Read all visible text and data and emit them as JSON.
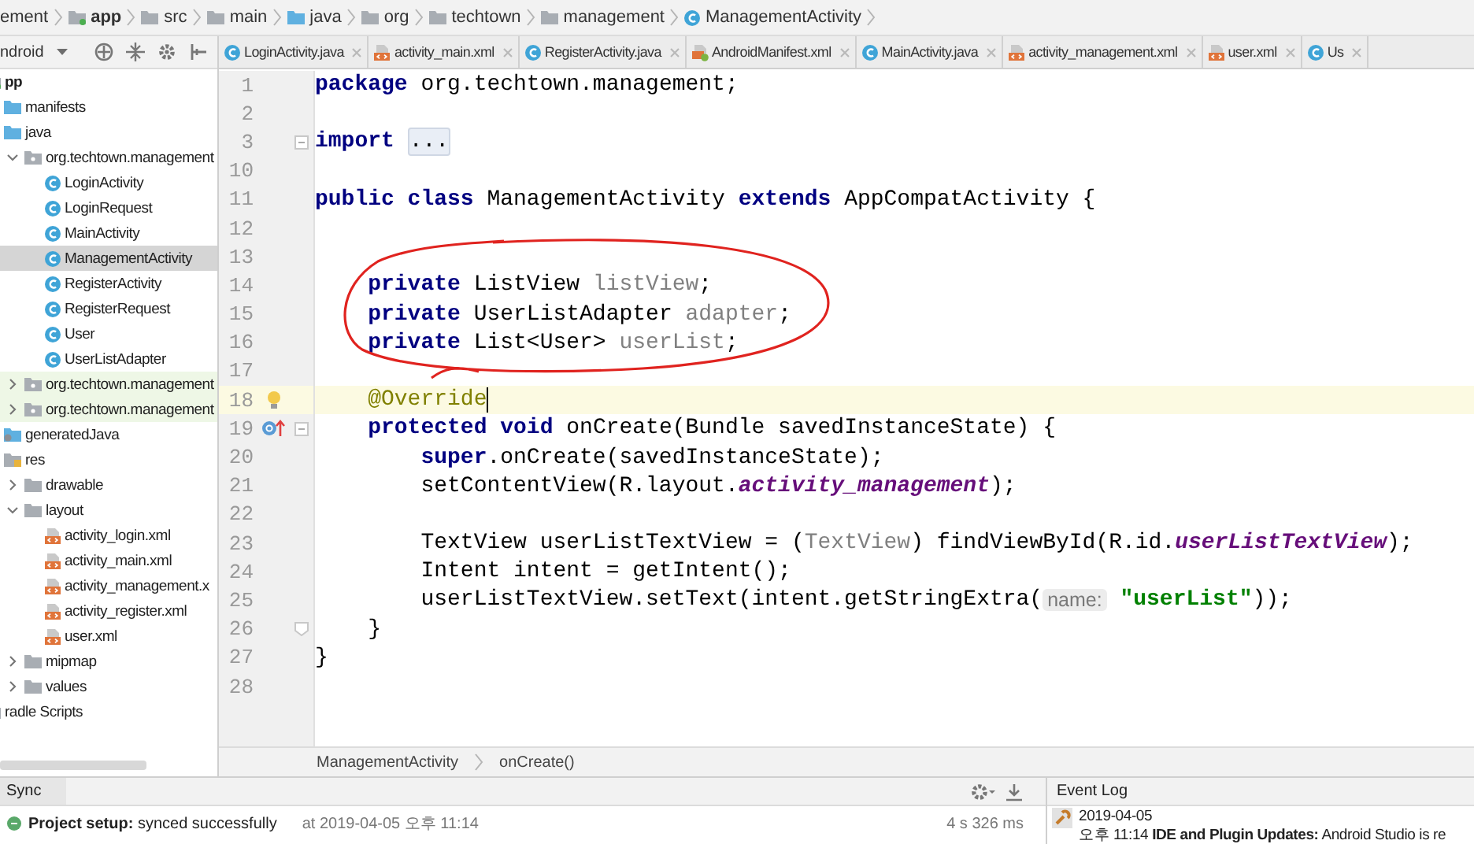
{
  "breadcrumb": [
    {
      "label": "ement",
      "kind": "plain"
    },
    {
      "label": "app",
      "kind": "module"
    },
    {
      "label": "src",
      "kind": "folder"
    },
    {
      "label": "main",
      "kind": "folder"
    },
    {
      "label": "java",
      "kind": "source-folder"
    },
    {
      "label": "org",
      "kind": "folder"
    },
    {
      "label": "techtown",
      "kind": "folder"
    },
    {
      "label": "management",
      "kind": "folder"
    },
    {
      "label": "ManagementActivity",
      "kind": "class"
    }
  ],
  "project_panel": {
    "view_selector": "ndroid",
    "tree": [
      {
        "label": "pp",
        "kind": "module",
        "children": [
          {
            "label": "manifests",
            "kind": "source-folder"
          },
          {
            "label": "java",
            "kind": "source-folder",
            "children": [
              {
                "label": "org.techtown.management",
                "kind": "package",
                "expanded": true,
                "children": [
                  {
                    "label": "LoginActivity",
                    "kind": "class",
                    "selected": false
                  },
                  {
                    "label": "LoginRequest",
                    "kind": "class",
                    "selected": false
                  },
                  {
                    "label": "MainActivity",
                    "kind": "class",
                    "selected": false
                  },
                  {
                    "label": "ManagementActivity",
                    "kind": "class",
                    "selected": true
                  },
                  {
                    "label": "RegisterActivity",
                    "kind": "class",
                    "selected": false
                  },
                  {
                    "label": "RegisterRequest",
                    "kind": "class",
                    "selected": false
                  },
                  {
                    "label": "User",
                    "kind": "class",
                    "selected": false
                  },
                  {
                    "label": "UserListAdapter",
                    "kind": "class",
                    "selected": false
                  }
                ]
              },
              {
                "label": "org.techtown.management",
                "kind": "test-package",
                "expanded": false
              },
              {
                "label": "org.techtown.management",
                "kind": "test-package",
                "expanded": false
              }
            ]
          },
          {
            "label": "generatedJava",
            "kind": "generated"
          },
          {
            "label": "res",
            "kind": "res",
            "children": [
              {
                "label": "drawable",
                "kind": "folder",
                "expanded": false
              },
              {
                "label": "layout",
                "kind": "folder",
                "expanded": true,
                "children": [
                  {
                    "label": "activity_login.xml",
                    "kind": "xml",
                    "selected": false
                  },
                  {
                    "label": "activity_main.xml",
                    "kind": "xml",
                    "selected": false
                  },
                  {
                    "label": "activity_management.x",
                    "kind": "xml",
                    "selected": false
                  },
                  {
                    "label": "activity_register.xml",
                    "kind": "xml",
                    "selected": false
                  },
                  {
                    "label": "user.xml",
                    "kind": "xml",
                    "selected": false
                  }
                ]
              },
              {
                "label": "mipmap",
                "kind": "folder",
                "expanded": false
              },
              {
                "label": "values",
                "kind": "folder",
                "expanded": false
              }
            ]
          }
        ]
      },
      {
        "label": "radle Scripts",
        "kind": "gradle"
      }
    ]
  },
  "tabs": [
    {
      "label": "LoginActivity.java",
      "kind": "class",
      "selected": false
    },
    {
      "label": "activity_main.xml",
      "kind": "xml",
      "selected": false
    },
    {
      "label": "RegisterActivity.java",
      "kind": "class",
      "selected": false
    },
    {
      "label": "AndroidManifest.xml",
      "kind": "manifest",
      "selected": false
    },
    {
      "label": "MainActivity.java",
      "kind": "class",
      "selected": false
    },
    {
      "label": "activity_management.xml",
      "kind": "xml",
      "selected": false
    },
    {
      "label": "user.xml",
      "kind": "xml",
      "selected": false
    },
    {
      "label": "Us",
      "kind": "class",
      "selected": false
    }
  ],
  "editor": {
    "lines": [
      {
        "number": "1",
        "tokens": [
          {
            "t": "package",
            "kind": "keyword"
          },
          {
            "t": " org.techtown.management;",
            "kind": "plain"
          }
        ]
      },
      {
        "number": "2"
      },
      {
        "number": "3",
        "foldable": true,
        "tokens": [
          {
            "t": "import ",
            "kind": "keyword"
          },
          {
            "t": "...",
            "kind": "folded"
          }
        ]
      },
      {
        "number": "10"
      },
      {
        "number": "11",
        "tokens": [
          {
            "t": "public class",
            "kind": "keyword"
          },
          {
            "t": " ManagementActivity ",
            "kind": "plain"
          },
          {
            "t": "extends",
            "kind": "keyword"
          },
          {
            "t": " AppCompatActivity {",
            "kind": "plain"
          }
        ]
      },
      {
        "number": "12"
      },
      {
        "number": "13"
      },
      {
        "number": "14",
        "tokens": [
          {
            "t": "    private",
            "kind": "keyword"
          },
          {
            "t": " ListView ",
            "kind": "plain"
          },
          {
            "t": "listView",
            "kind": "unused"
          },
          {
            "t": ";",
            "kind": "plain"
          }
        ]
      },
      {
        "number": "15",
        "tokens": [
          {
            "t": "    private",
            "kind": "keyword"
          },
          {
            "t": " UserListAdapter ",
            "kind": "plain"
          },
          {
            "t": "adapter",
            "kind": "unused"
          },
          {
            "t": ";",
            "kind": "plain"
          }
        ]
      },
      {
        "number": "16",
        "tokens": [
          {
            "t": "    private",
            "kind": "keyword"
          },
          {
            "t": " List<User> ",
            "kind": "plain"
          },
          {
            "t": "userList",
            "kind": "unused"
          },
          {
            "t": ";",
            "kind": "plain"
          }
        ]
      },
      {
        "number": "17"
      },
      {
        "number": "18",
        "current": true,
        "intention_bulb": true,
        "tokens": [
          {
            "t": "    @Override",
            "kind": "annotation"
          }
        ]
      },
      {
        "number": "19",
        "overrides": true,
        "foldable": true,
        "tokens": [
          {
            "t": "    protected void",
            "kind": "keyword"
          },
          {
            "t": " onCreate(Bundle savedInstanceState) {",
            "kind": "plain"
          }
        ]
      },
      {
        "number": "20",
        "tokens": [
          {
            "t": "        super",
            "kind": "keyword"
          },
          {
            "t": ".onCreate(savedInstanceState);",
            "kind": "plain"
          }
        ]
      },
      {
        "number": "21",
        "tokens": [
          {
            "t": "        setContentView(R.layout.",
            "kind": "plain"
          },
          {
            "t": "activity_management",
            "kind": "static"
          },
          {
            "t": ");",
            "kind": "plain"
          }
        ]
      },
      {
        "number": "22"
      },
      {
        "number": "23",
        "tokens": [
          {
            "t": "        TextView userListTextView = (",
            "kind": "plain"
          },
          {
            "t": "TextView",
            "kind": "redundant"
          },
          {
            "t": ") findViewById(R.id.",
            "kind": "plain"
          },
          {
            "t": "userListTextView",
            "kind": "static"
          },
          {
            "t": ");",
            "kind": "plain"
          }
        ]
      },
      {
        "number": "24",
        "tokens": [
          {
            "t": "        Intent intent = getIntent();",
            "kind": "plain"
          }
        ]
      },
      {
        "number": "25",
        "tokens": [
          {
            "t": "        userListTextView.setText(intent.getStringExtra(",
            "kind": "plain"
          },
          {
            "t": "name:",
            "kind": "hint"
          },
          {
            "t": " \"userList\"",
            "kind": "string"
          },
          {
            "t": "));",
            "kind": "plain"
          }
        ]
      },
      {
        "number": "26",
        "fold_end": true,
        "tokens": [
          {
            "t": "    }",
            "kind": "plain"
          }
        ]
      },
      {
        "number": "27",
        "tokens": [
          {
            "t": "}",
            "kind": "plain"
          }
        ]
      },
      {
        "number": "28"
      }
    ],
    "breadcrumb": [
      "ManagementActivity",
      "onCreate()"
    ]
  },
  "build_panel": {
    "tab": "Sync",
    "status": "**Project setup:** synced successfully",
    "time": "at 2019-04-05 오후 11:14",
    "duration": "4 s 326 ms"
  },
  "event_log": {
    "title": "Event Log",
    "date": "2019-04-05",
    "message": "오후 11:14 **IDE and Plugin Updates:** Android Studio is re"
  }
}
